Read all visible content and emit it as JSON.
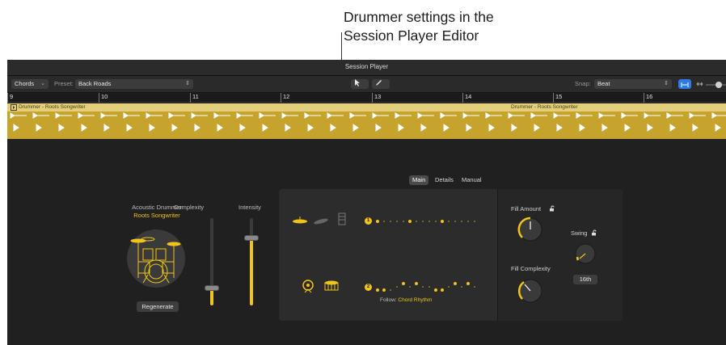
{
  "callout": {
    "line1": "Drummer settings in the",
    "line2": "Session Player Editor"
  },
  "window": {
    "title": "Session Player"
  },
  "toolbar": {
    "chords_label": "Chords",
    "preset_label": "Preset:",
    "preset_value": "Back Roads",
    "snap_label": "Snap:",
    "snap_value": "Beat",
    "pointer_tool_icon": "arrow-pointer-icon",
    "pencil_tool_icon": "pencil-icon"
  },
  "ruler": {
    "bars": [
      "9",
      "10",
      "11",
      "12",
      "13",
      "14",
      "15",
      "16"
    ]
  },
  "regions": [
    {
      "name": "Drummer - Roots Songwriter"
    },
    {
      "name": "Drummer - Roots Songwriter"
    }
  ],
  "tabs": [
    {
      "label": "Main",
      "active": true
    },
    {
      "label": "Details",
      "active": false
    },
    {
      "label": "Manual",
      "active": false
    }
  ],
  "drummer": {
    "title": "Acoustic Drummer",
    "name": "Roots Songwriter",
    "regenerate_label": "Regenerate"
  },
  "complexity": {
    "label": "Complexity",
    "level": 0.2
  },
  "intensity": {
    "label": "Intensity",
    "level": 0.78
  },
  "rows": [
    {
      "badge": "1"
    },
    {
      "badge": "2"
    }
  ],
  "follow": {
    "label": "Follow:",
    "value": "Chord Rhythm"
  },
  "fill_amount": {
    "label": "Fill Amount"
  },
  "fill_complexity": {
    "label": "Fill Complexity"
  },
  "swing": {
    "label": "Swing",
    "value": "16th"
  },
  "colors": {
    "accent": "#f0c419",
    "region": "#c6a32c",
    "background": "#202020"
  }
}
